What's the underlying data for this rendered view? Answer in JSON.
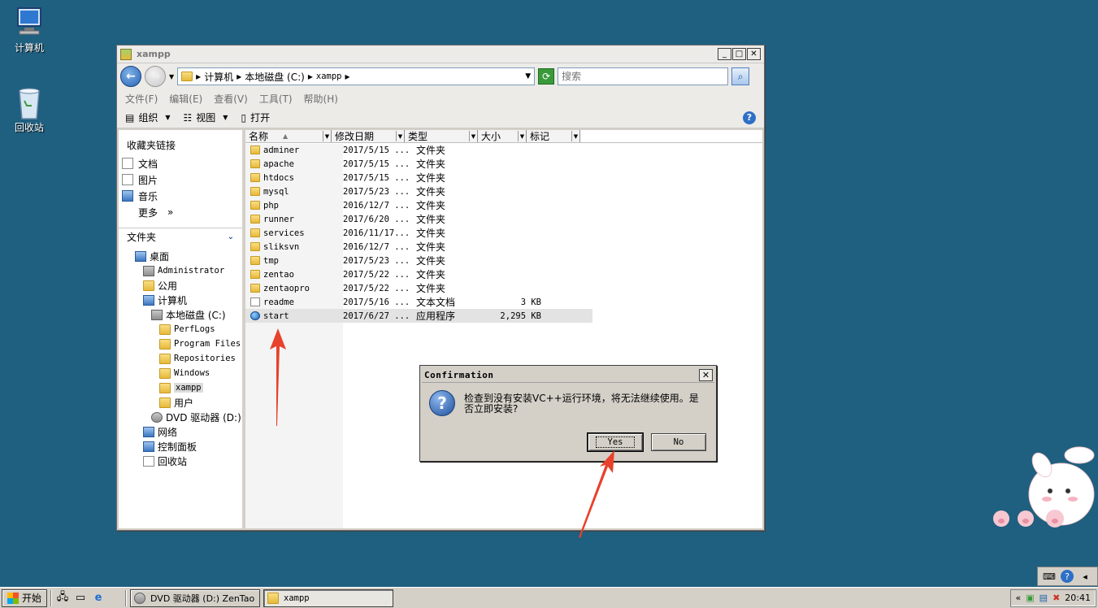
{
  "desktop": {
    "computer_label": "计算机",
    "recycle_label": "回收站"
  },
  "window": {
    "title": "xampp",
    "address": {
      "crumbs": [
        "计算机",
        "本地磁盘 (C:)",
        "xampp"
      ]
    },
    "search_placeholder": "搜索",
    "menu": [
      "文件(F)",
      "编辑(E)",
      "查看(V)",
      "工具(T)",
      "帮助(H)"
    ],
    "toolbar": {
      "organize": "组织",
      "views": "视图",
      "open": "打开"
    },
    "favorites_heading": "收藏夹链接",
    "favorites": [
      "文档",
      "图片",
      "音乐"
    ],
    "more_label": "更多",
    "more_chevron": "»",
    "folders_heading": "文件夹",
    "tree": {
      "desktop": "桌面",
      "administrator": "Administrator",
      "public": "公用",
      "computer": "计算机",
      "local_disk": "本地磁盘 (C:)",
      "perflogs": "PerfLogs",
      "program_files": "Program Files",
      "repositories": "Repositories",
      "windows": "Windows",
      "xampp": "xampp",
      "users": "用户",
      "dvd": "DVD 驱动器 (D:)",
      "network": "网络",
      "control_panel": "控制面板",
      "recycle": "回收站"
    },
    "columns": {
      "name": "名称",
      "modified": "修改日期",
      "type": "类型",
      "size": "大小",
      "tags": "标记"
    },
    "files": [
      {
        "name": "adminer",
        "date": "2017/5/15 ...",
        "type": "文件夹",
        "size": "",
        "kind": "folder"
      },
      {
        "name": "apache",
        "date": "2017/5/15 ...",
        "type": "文件夹",
        "size": "",
        "kind": "folder"
      },
      {
        "name": "htdocs",
        "date": "2017/5/15 ...",
        "type": "文件夹",
        "size": "",
        "kind": "folder"
      },
      {
        "name": "mysql",
        "date": "2017/5/23 ...",
        "type": "文件夹",
        "size": "",
        "kind": "folder"
      },
      {
        "name": "php",
        "date": "2016/12/7 ...",
        "type": "文件夹",
        "size": "",
        "kind": "folder"
      },
      {
        "name": "runner",
        "date": "2017/6/20 ...",
        "type": "文件夹",
        "size": "",
        "kind": "folder"
      },
      {
        "name": "services",
        "date": "2016/11/17...",
        "type": "文件夹",
        "size": "",
        "kind": "folder"
      },
      {
        "name": "sliksvn",
        "date": "2016/12/7 ...",
        "type": "文件夹",
        "size": "",
        "kind": "folder"
      },
      {
        "name": "tmp",
        "date": "2017/5/23 ...",
        "type": "文件夹",
        "size": "",
        "kind": "folder"
      },
      {
        "name": "zentao",
        "date": "2017/5/22 ...",
        "type": "文件夹",
        "size": "",
        "kind": "folder"
      },
      {
        "name": "zentaopro",
        "date": "2017/5/22 ...",
        "type": "文件夹",
        "size": "",
        "kind": "folder"
      },
      {
        "name": "readme",
        "date": "2017/5/16 ...",
        "type": "文本文档",
        "size": "3 KB",
        "kind": "text"
      },
      {
        "name": "start",
        "date": "2017/6/27 ...",
        "type": "应用程序",
        "size": "2,295 KB",
        "kind": "app"
      }
    ]
  },
  "dialog": {
    "title": "Confirmation",
    "message": "检查到没有安装VC++运行环境，将无法继续使用。是否立即安装?",
    "yes": "Yes",
    "no": "No"
  },
  "taskbar": {
    "start": "开始",
    "tasks": [
      "DVD 驱动器 (D:) ZenTao",
      "xampp"
    ],
    "tray_expand": "«",
    "clock": "20:41"
  },
  "colors": {
    "desktop": "#1f5f7f",
    "arrow": "#e8412c"
  }
}
